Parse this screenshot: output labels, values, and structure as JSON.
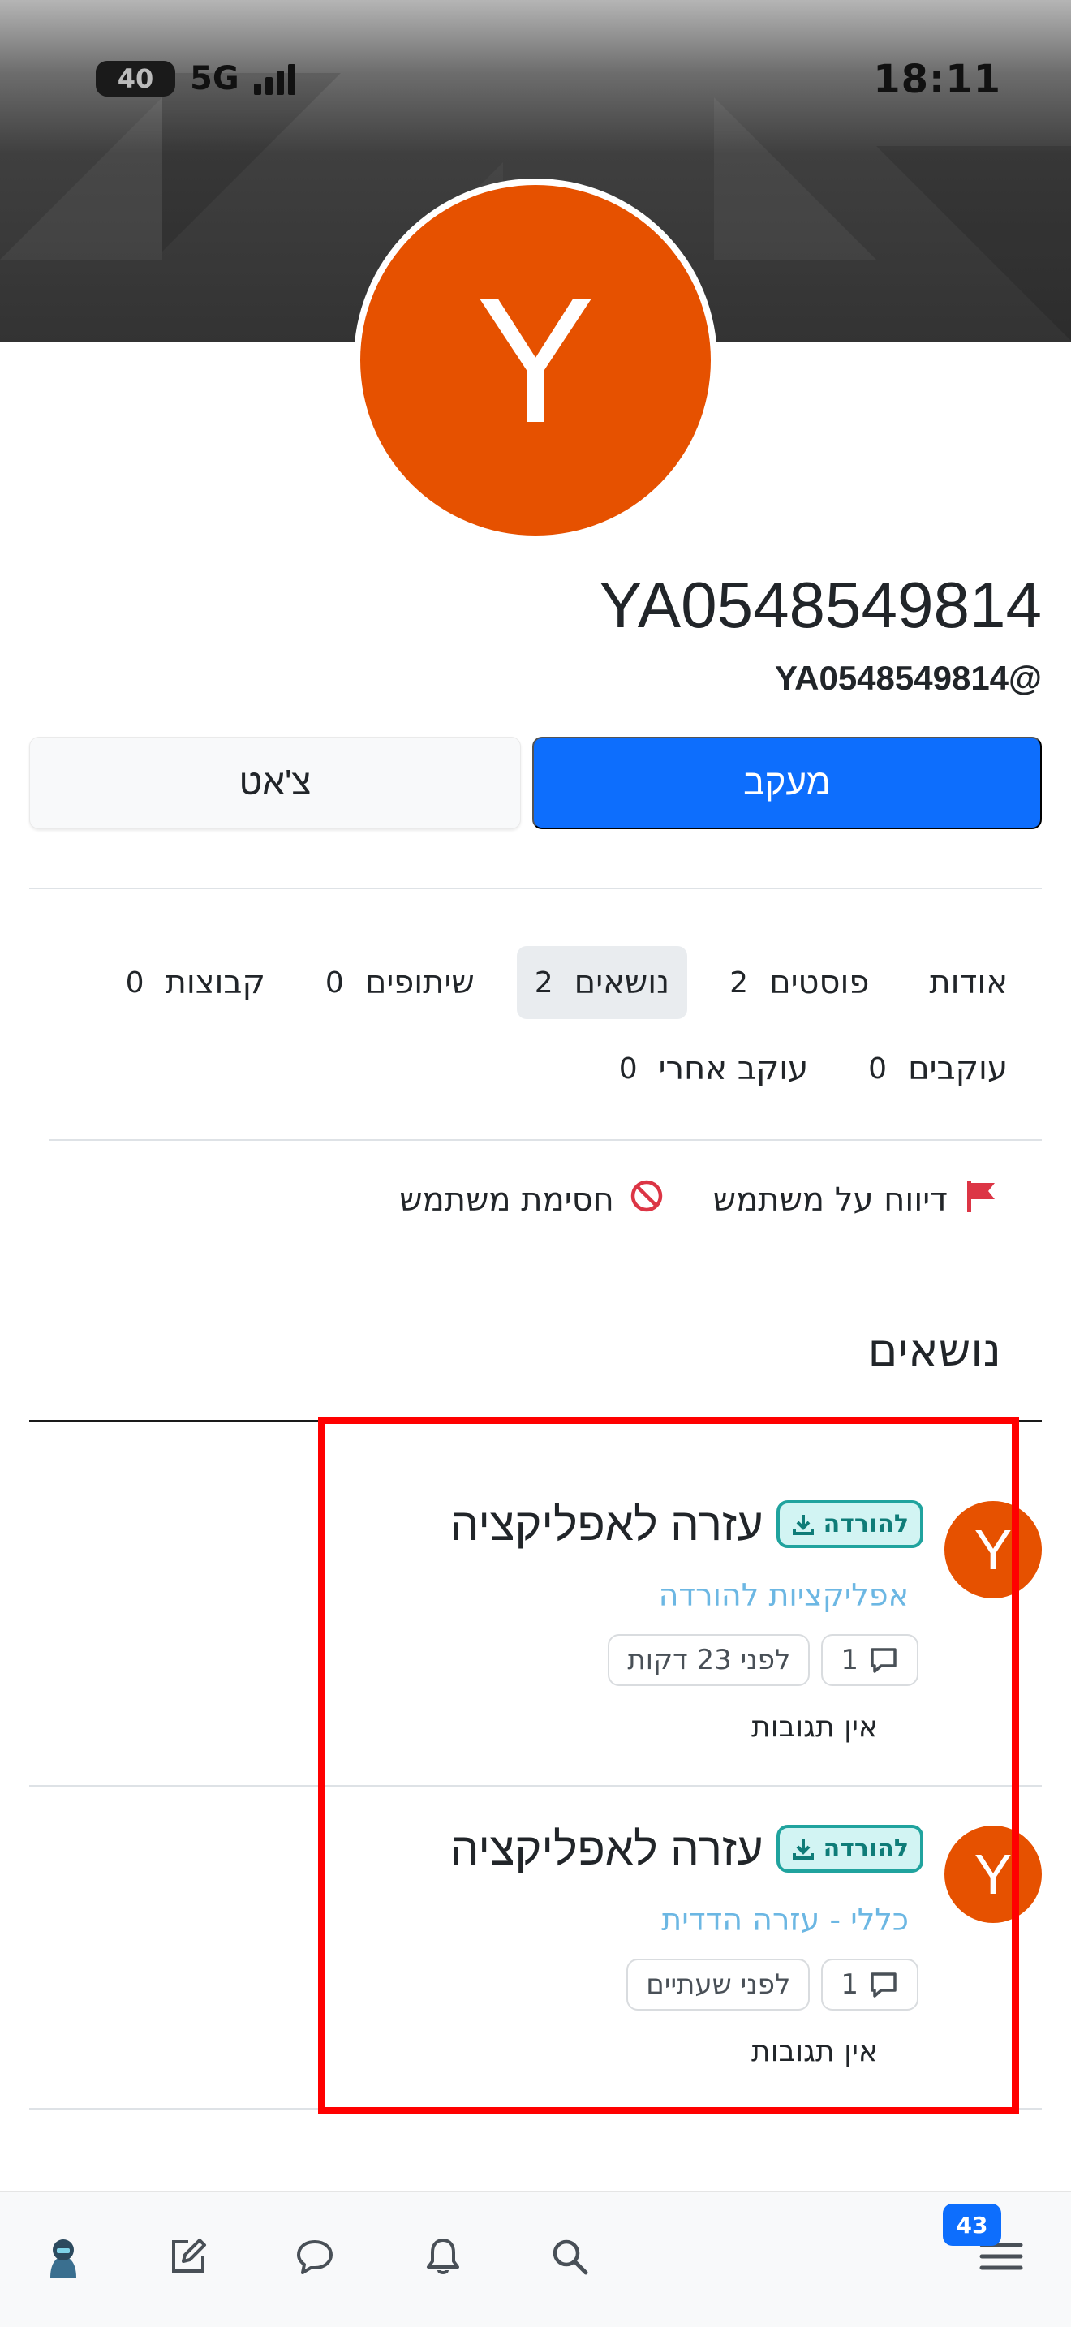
{
  "status_bar": {
    "time": "18:11",
    "battery": "40",
    "network": "5G"
  },
  "profile": {
    "avatar_letter": "Y",
    "display_name": "YA0548549814",
    "username": "YA0548549814@",
    "follow_label": "מעקב",
    "chat_label": "צ'אט"
  },
  "profile_nav": [
    {
      "label": "אודות",
      "count": ""
    },
    {
      "label": "פוסטים",
      "count": "2"
    },
    {
      "label": "נושאים",
      "count": "2",
      "active": true
    },
    {
      "label": "שיתופים",
      "count": "0"
    },
    {
      "label": "קבוצות",
      "count": "0"
    },
    {
      "label": "עוקבים",
      "count": "0"
    },
    {
      "label": "עוקב אחרי",
      "count": "0"
    }
  ],
  "actions": {
    "report_label": "דיווח על משתמש",
    "block_label": "חסימת משתמש"
  },
  "section": {
    "title": "נושאים"
  },
  "topics": [
    {
      "avatar_letter": "Y",
      "tag": "להורדה",
      "title": "עזרה לאפליקציה",
      "category": "אפליקציות להורדה",
      "reply_count": "1",
      "time": "לפני 23 דקות",
      "no_replies": "אין תגובות"
    },
    {
      "avatar_letter": "Y",
      "tag": "להורדה",
      "title": "עזרה לאפליקציה",
      "category": "כללי - עזרה הדדית",
      "reply_count": "1",
      "time": "לפני שעתיים",
      "no_replies": "אין תגובות"
    }
  ],
  "bottom_bar": {
    "notification_count": "43"
  },
  "colors": {
    "accent": "#0d6efd",
    "avatar": "#e65100",
    "tag": "#20a39e",
    "category": "#6cb7e3",
    "highlight": "#ff0000"
  }
}
